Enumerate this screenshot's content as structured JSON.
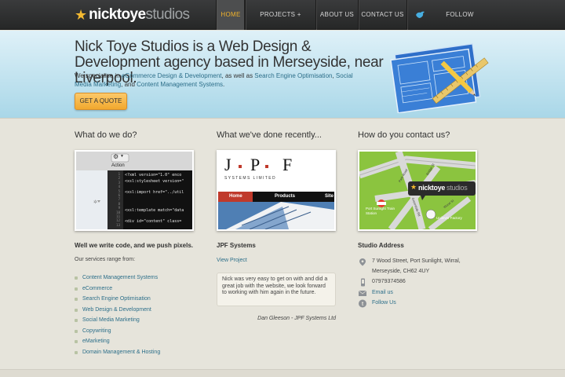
{
  "nav": {
    "logo_primary": "nicktoye",
    "logo_secondary": "studios",
    "items": [
      {
        "label": "HOME"
      },
      {
        "label": "PROJECTS + SERVICES"
      },
      {
        "label": "ABOUT US"
      },
      {
        "label": "CONTACT US"
      },
      {
        "label": "FOLLOW @NICKTOYE"
      }
    ],
    "active_label": "HOME",
    "accent_color": "#f0b22c"
  },
  "hero": {
    "title": "Nick Toye Studios is a Web Design & Development agency based in Merseyside, near Liverpool.",
    "intro_prefix": "We specialise in ",
    "intro_link_1": "eCommerce Design & Development",
    "intro_mid_1": ", as well as ",
    "intro_link_2": "Search Engine Optimisation",
    "intro_mid_2": ", ",
    "intro_link_3": "Social Media Marketing",
    "intro_mid_3": ", and ",
    "intro_link_4": "Content Management Systems",
    "intro_suffix": ".",
    "cta_label": "GET A QUOTE"
  },
  "what_we_do": {
    "heading": "What do we do?",
    "action_label": "Action",
    "code_lines": [
      "<?xml version=\"1.0\" enco",
      "<xsl:stylesheet version=\"",
      "",
      "<xsl:import href=\"../util",
      "",
      "",
      "<xsl:template match=\"data",
      "",
      "<div id=\"content\" class="
    ],
    "line_numbers": [
      "1",
      "2",
      "3",
      "4",
      "5",
      "6",
      "7",
      "8",
      "9",
      "10",
      "11",
      "12",
      "13"
    ],
    "tagline": "Well we write code, and we push pixels.",
    "services_intro": "Our services range from:",
    "services": [
      "Content Management Systems",
      "eCommerce",
      "Search Engine Optimisation",
      "Web Design & Development",
      "Social Media Marketing",
      "Copywriting",
      "eMarketing",
      "Domain Management & Hosting"
    ]
  },
  "recent_work": {
    "heading": "What we've done recently...",
    "jpf_letters": [
      "J",
      "P",
      "F"
    ],
    "jpf_subtitle": "SYSTEMS LIMITED",
    "jpf_nav": [
      "Home",
      "Products",
      "Site"
    ],
    "project_name": "JPF Systems",
    "view_label": "View Project",
    "testimonial": "Nick was very easy to get on with and did a great job with the website, we look forward to working with him again in the future.",
    "author": "Dan Gleeson - JPF Systems Ltd"
  },
  "contact": {
    "heading": "How do you contact us?",
    "map_logo_primary": "nicktoye",
    "map_logo_secondary": "studios",
    "map_labels": [
      "Port Sunlight Train Station",
      "Unilever Factory",
      "Park Road",
      "Bridge St",
      "Greendale Rd",
      "Wood St"
    ],
    "address_title": "Studio Address",
    "address_line_1": "7 Wood Street, Port Sunlight, Wirral,",
    "address_line_2": "Merseyside, CH62 4UY",
    "phone": "07979374586",
    "email_label": "Email us",
    "follow_label": "Follow Us"
  }
}
